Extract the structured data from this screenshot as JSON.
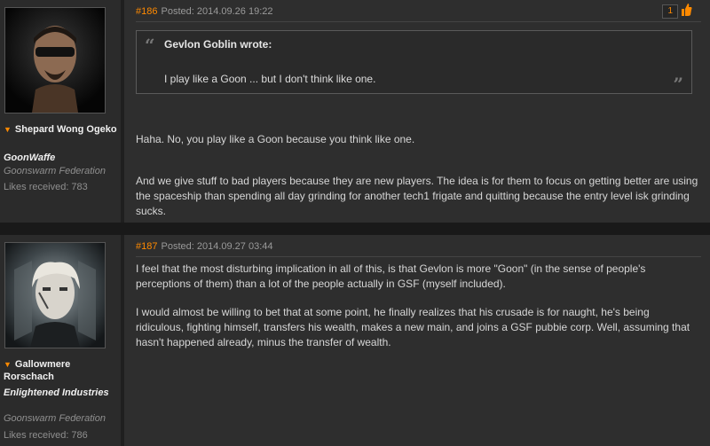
{
  "posts": [
    {
      "user": {
        "name": "Shepard Wong Ogeko",
        "corp": "GoonWaffe",
        "alliance": "Goonswarm Federation",
        "likes": "Likes received: 783"
      },
      "number": "#186",
      "posted": "Posted: 2014.09.26 19:22",
      "like_count": "1",
      "quote": {
        "author": "Gevlon Goblin wrote:",
        "text": "I play like a Goon ... but I don't think like one."
      },
      "paragraphs": [
        "Haha. No, you play like a Goon because you think like one.",
        "And we give stuff to bad players because they are new players. The idea is for them to focus on getting better are using the spaceship than spending all day grinding for another tech1 frigate and quitting because the entry level isk grinding sucks."
      ]
    },
    {
      "user": {
        "name": "Gallowmere Rorschach",
        "corp": "Enlightened Industries",
        "alliance": "Goonswarm Federation",
        "likes": "Likes received: 786"
      },
      "number": "#187",
      "posted": "Posted: 2014.09.27 03:44",
      "paragraphs": [
        "I feel that the most disturbing implication in all of this, is that Gevlon is more \"Goon\" (in the sense of people's perceptions of them) than a lot of the people actually in GSF (myself included).",
        "I would almost be willing to bet that at some point, he finally realizes that his crusade is for naught, he's being ridiculous, fighting himself, transfers his wealth, makes a new main, and joins a GSF pubbie corp. Well, assuming that hasn't happened already, minus the transfer of wealth."
      ]
    }
  ],
  "colors": {
    "accent": "#ff8a00",
    "page_bg": "#1f1f1f",
    "post_bg": "#2e2e2e",
    "sidebar_bg": "#2b2b2b"
  },
  "icons": {
    "user_menu": "triangle-down-icon",
    "like": "thumbs-up-icon",
    "quote_open": "quote-open-icon",
    "quote_close": "quote-close-icon"
  }
}
